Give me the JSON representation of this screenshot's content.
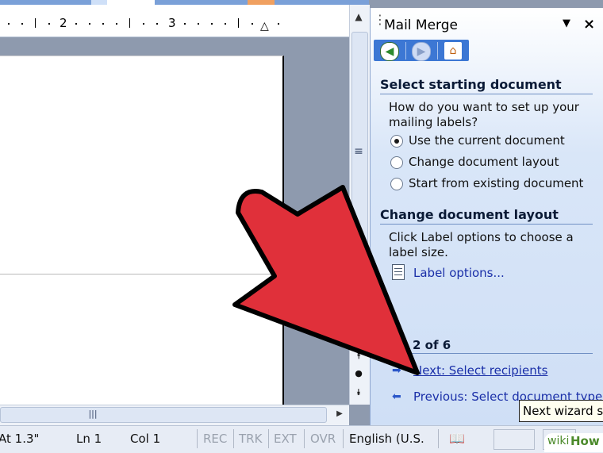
{
  "ruler": {
    "num_2": "2",
    "num_3": "3"
  },
  "task_pane": {
    "title": "Mail Merge",
    "nav": {
      "back_icon": "back-arrow-icon",
      "forward_icon": "forward-arrow-icon",
      "home_icon": "home-icon"
    },
    "section1": {
      "heading": "Select starting document",
      "question_line1": "How do you want to set up your",
      "question_line2": "mailing labels?",
      "options": [
        {
          "label": "Use the current document",
          "selected": true
        },
        {
          "label": "Change document layout",
          "selected": false
        },
        {
          "label": "Start from existing document",
          "selected": false
        }
      ]
    },
    "section2": {
      "heading": "Change document layout",
      "text_line1": "Click Label options to choose a",
      "text_line2": "label size.",
      "link": "Label options..."
    },
    "step": {
      "label": "2 of 6",
      "next": "Next: Select recipients",
      "previous": "Previous: Select document type"
    }
  },
  "tooltip": "Next wizard st",
  "status_bar": {
    "at": "At 1.3\"",
    "ln": "Ln 1",
    "col": "Col 1",
    "rec": "REC",
    "trk": "TRK",
    "ext": "EXT",
    "ovr": "OVR",
    "language": "English (U.S."
  },
  "watermark": {
    "part1": "wiki",
    "part2": "How"
  },
  "colors": {
    "arrow_red": "#e0303a",
    "link_blue": "#1a2fa8",
    "nav_blue": "#3c77d4"
  }
}
